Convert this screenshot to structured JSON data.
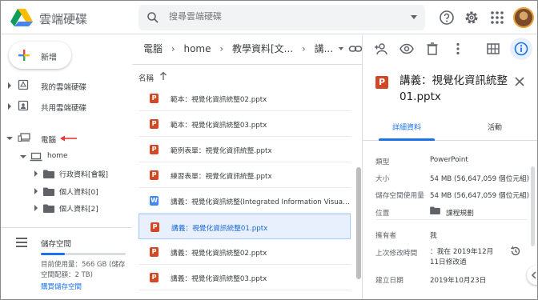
{
  "app": {
    "title": "雲端硬碟"
  },
  "search": {
    "placeholder": "搜尋雲端硬碟"
  },
  "sidebar": {
    "new_label": "新增",
    "items": [
      {
        "label": "我的雲端硬碟",
        "icon": "drive-icon"
      },
      {
        "label": "共用雲端硬碟",
        "icon": "shared-drive-icon"
      },
      {
        "label": "電腦",
        "icon": "computer-icon"
      }
    ],
    "tree": [
      {
        "label": "home",
        "icon": "laptop-icon"
      },
      {
        "label": "行政資料[會報]",
        "icon": "folder-icon"
      },
      {
        "label": "個人資料[0]",
        "icon": "folder-icon"
      },
      {
        "label": "個人資料[2]",
        "icon": "folder-icon"
      }
    ],
    "storage": {
      "title": "儲存空間",
      "usage_text": "目前使用量：566 GB (儲存空間配額：2 TB)",
      "used_fraction": 0.28,
      "buy_link": "購買儲存空間"
    }
  },
  "breadcrumb": {
    "items": [
      "電腦",
      "home",
      "教學資料[文...",
      "講..."
    ]
  },
  "file_list": {
    "column_name": "名稱",
    "files": [
      {
        "name": "範本：視覺化資訊統整02.pptx",
        "type": "P"
      },
      {
        "name": "範本：視覺化資訊統整03.pptx",
        "type": "P"
      },
      {
        "name": "範例表單：視覺化資訊統整.pptx",
        "type": "P"
      },
      {
        "name": "練習表單：視覺化資訊統整.pptx",
        "type": "P"
      },
      {
        "name": "講義：視覺化資訊統整(Integrated Information Visuali...",
        "type": "W"
      },
      {
        "name": "講義：視覺化資訊統整01.pptx",
        "type": "P"
      },
      {
        "name": "講義：視覺化資訊統整02.pptx",
        "type": "P"
      },
      {
        "name": "講義：視覺化資訊統整03.pptx",
        "type": "P"
      }
    ]
  },
  "details": {
    "icon_letter": "P",
    "title": "講義：視覺化資訊統整01.pptx",
    "tabs": [
      "詳細資料",
      "活動"
    ],
    "properties": {
      "type_label": "類型",
      "type_value": "PowerPoint",
      "size_label": "大小",
      "size_value": "54 MB (56,647,059 個位元組)",
      "storage_label": "儲存空間使用量",
      "storage_value": "54 MB (56,647,059 個位元組)",
      "location_label": "位置",
      "location_value": "課程規劃",
      "owner_label": "擁有者",
      "owner_value": "我",
      "modified_label": "上次修改時間",
      "modified_value": "：我在 2019年12月11日修改過",
      "created_label": "建立日期",
      "created_value": "2019年10月23日"
    }
  },
  "colors": {
    "accent": "#1a73e8",
    "pptx": "#d24726",
    "docx": "#4285f4",
    "selected_bg": "#e8f0fe"
  }
}
